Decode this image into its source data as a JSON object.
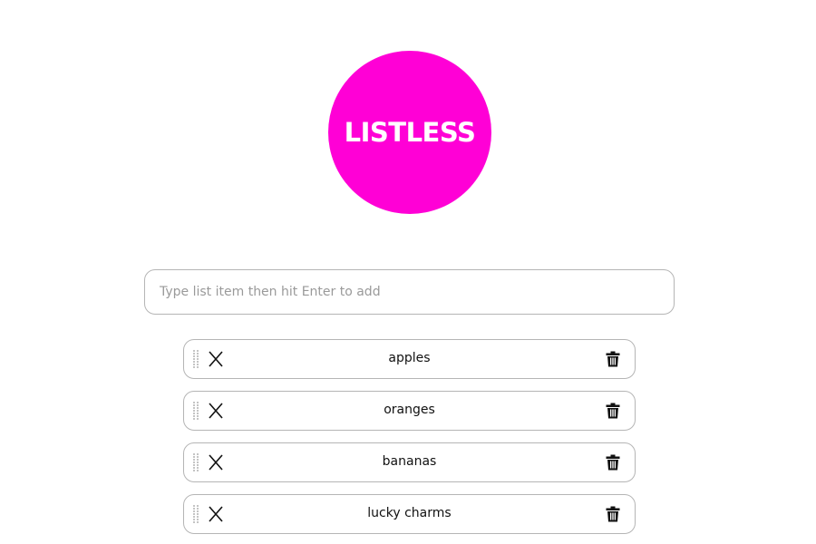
{
  "app": {
    "logo_text": "LISTLESS",
    "accent_color": "#ff00d6"
  },
  "add_input": {
    "placeholder": "Type list item then hit Enter to add",
    "value": ""
  },
  "items": [
    {
      "label": "apples"
    },
    {
      "label": "oranges"
    },
    {
      "label": "bananas"
    },
    {
      "label": "lucky charms"
    }
  ],
  "icons": {
    "drag": "drag-handle-icon",
    "done": "close-x-icon",
    "delete": "trash-icon"
  }
}
